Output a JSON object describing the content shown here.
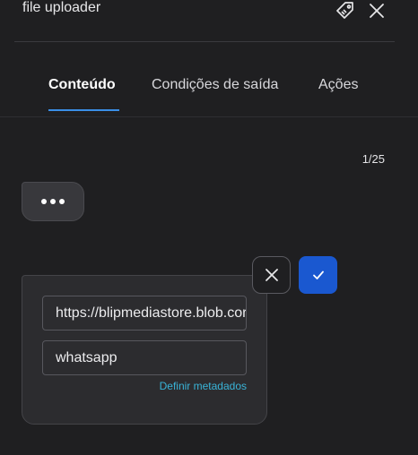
{
  "header": {
    "title": "file uploader",
    "icons": [
      "tag-icon",
      "close-icon"
    ]
  },
  "tabs": [
    {
      "label": "Conteúdo",
      "active": true
    },
    {
      "label": "Condições de saída",
      "active": false
    },
    {
      "label": "Ações",
      "active": false
    }
  ],
  "content": {
    "page_counter": "1/25",
    "url_field_value": "https://blipmediastore.blob.core.windows.net",
    "channel_field_value": "whatsapp",
    "metadata_link": "Definir metadados"
  },
  "colors": {
    "background": "#1f1f21",
    "accent_blue": "#1a58d0",
    "tab_underline": "#3a8fe6",
    "link": "#39b4d8"
  }
}
